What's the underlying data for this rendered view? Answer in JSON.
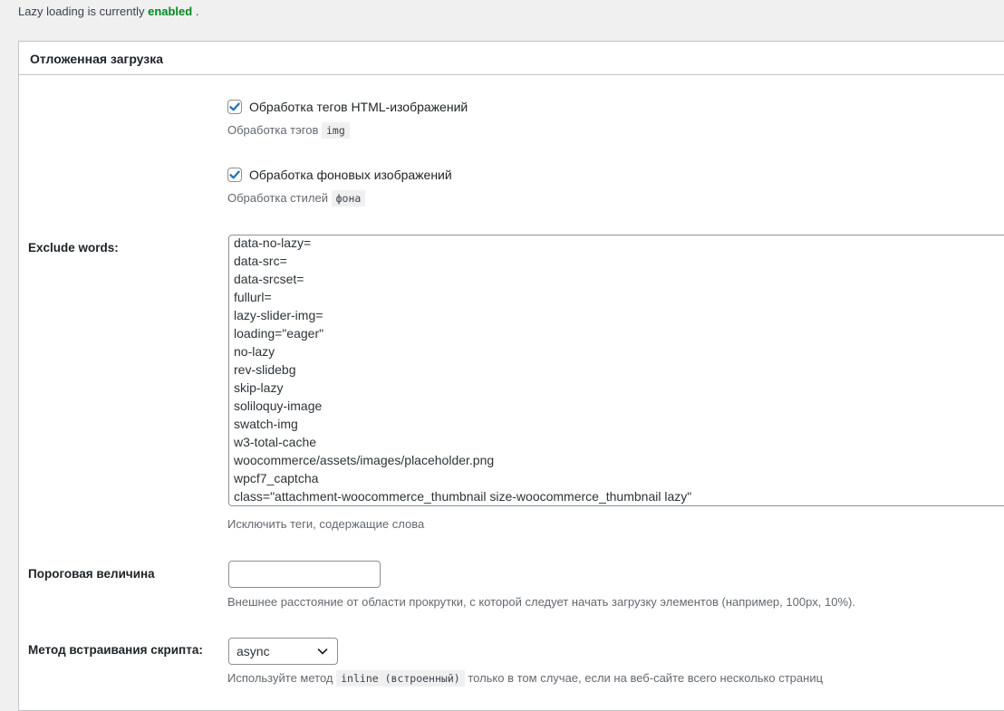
{
  "status": {
    "prefix": "Lazy loading is currently",
    "state": "enabled",
    "suffix": "."
  },
  "panel": {
    "title": "Отложенная загрузка"
  },
  "options": {
    "html_images": {
      "label": "Обработка тегов HTML-изображений",
      "checked": true,
      "desc_prefix": "Обработка тэгов",
      "desc_code": "img"
    },
    "background_images": {
      "label": "Обработка фоновых изображений",
      "checked": true,
      "desc_prefix": "Обработка стилей",
      "desc_code": "фона"
    }
  },
  "exclude": {
    "label": "Exclude words:",
    "lines": [
      "data-no-lazy=",
      "data-src=",
      "data-srcset=",
      "fullurl=",
      "lazy-slider-img=",
      "loading=\"eager\"",
      "no-lazy",
      "rev-slidebg",
      "skip-lazy",
      "soliloquy-image",
      "swatch-img",
      "w3-total-cache",
      "woocommerce/assets/images/placeholder.png",
      "wpcf7_captcha",
      "class=\"attachment-woocommerce_thumbnail size-woocommerce_thumbnail lazy\""
    ],
    "description": "Исключить теги, содержащие слова"
  },
  "threshold": {
    "label": "Пороговая величина",
    "value": "",
    "description": "Внешнее расстояние от области прокрутки, с которой следует начать загрузку элементов (например, 100px, 10%)."
  },
  "embed_method": {
    "label": "Метод встраивания скрипта:",
    "selected": "async",
    "desc_prefix": "Используйте метод",
    "desc_code": "inline (встроенный)",
    "desc_suffix": "только в том случае, если на веб-сайте всего несколько страниц"
  }
}
